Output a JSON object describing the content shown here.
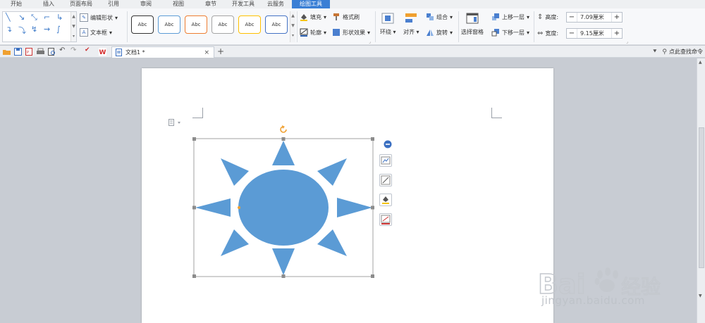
{
  "menu": {
    "items": [
      "开始",
      "插入",
      "页面布局",
      "引用",
      "审阅",
      "视图",
      "章节",
      "开发工具",
      "云服务",
      "绘图工具"
    ],
    "active": "绘图工具"
  },
  "ribbon": {
    "edit_shape": "编辑形状",
    "text_box": "文本框",
    "style_label": "Abc",
    "style_colors": [
      "#333333",
      "#5b9bd5",
      "#ed7d31",
      "#a5a5a5",
      "#ffc000",
      "#4472c4"
    ],
    "fill": "填充",
    "format_painter": "格式刷",
    "outline": "轮廓",
    "shape_effects": "形状效果",
    "wrap": "环绕",
    "align": "对齐",
    "group": "组合",
    "rotate": "旋转",
    "selection_pane": "选择窗格",
    "bring_forward": "上移一层",
    "send_backward": "下移一层",
    "height_label": "高度:",
    "height_value": "7.09厘米",
    "width_label": "宽度:",
    "width_value": "9.15厘米",
    "minus": "−",
    "plus": "+"
  },
  "tabs": {
    "doc_title": "文档1 *",
    "close": "×",
    "new_tab": "+",
    "find_command": "点此查找命令"
  },
  "canvas": {
    "sun_color": "#5b9bd5",
    "rotate_handle_color": "#f0a030",
    "handle_color": "#8c8c8c"
  },
  "watermark": {
    "logo_text": "Bai",
    "logo_suffix": "经验",
    "url": "jingyan.baidu.com"
  }
}
